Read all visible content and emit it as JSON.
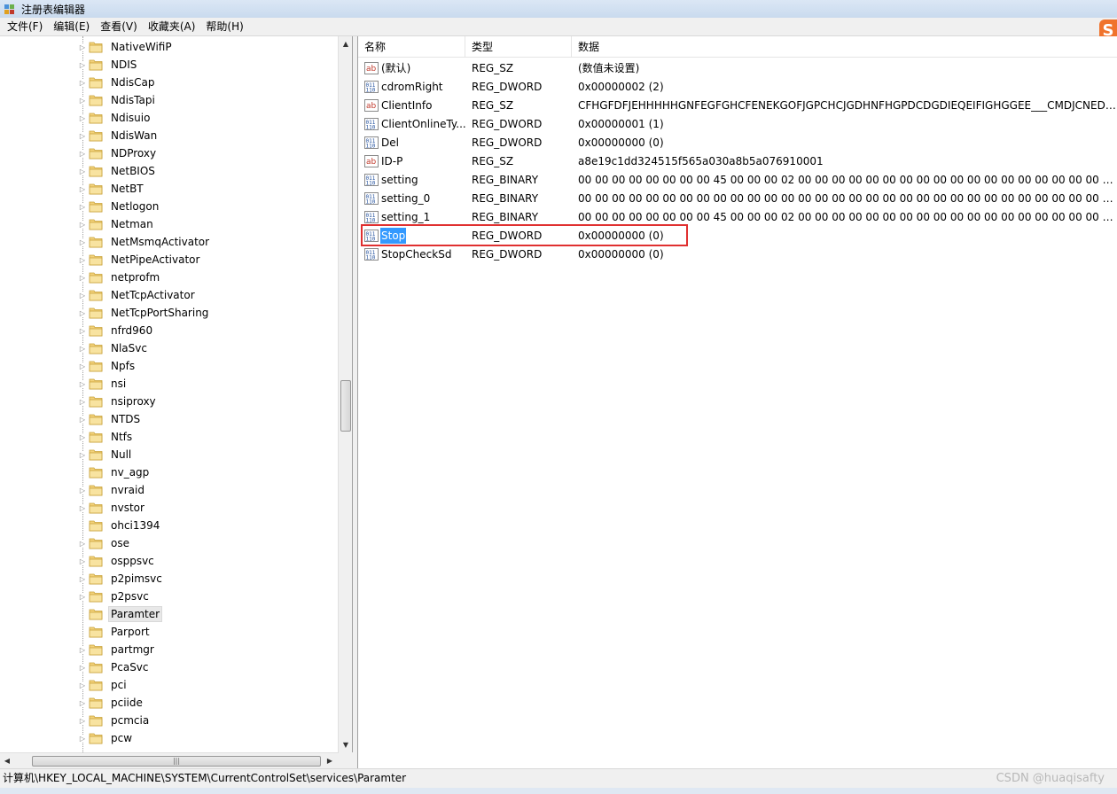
{
  "window": {
    "title": "注册表编辑器"
  },
  "menu": [
    "文件(F)",
    "编辑(E)",
    "查看(V)",
    "收藏夹(A)",
    "帮助(H)"
  ],
  "tree": {
    "items": [
      {
        "label": "NativeWifiP",
        "expandable": true
      },
      {
        "label": "NDIS",
        "expandable": true
      },
      {
        "label": "NdisCap",
        "expandable": true
      },
      {
        "label": "NdisTapi",
        "expandable": true
      },
      {
        "label": "Ndisuio",
        "expandable": true
      },
      {
        "label": "NdisWan",
        "expandable": true
      },
      {
        "label": "NDProxy",
        "expandable": true
      },
      {
        "label": "NetBIOS",
        "expandable": true
      },
      {
        "label": "NetBT",
        "expandable": true
      },
      {
        "label": "Netlogon",
        "expandable": true
      },
      {
        "label": "Netman",
        "expandable": true
      },
      {
        "label": "NetMsmqActivator",
        "expandable": true
      },
      {
        "label": "NetPipeActivator",
        "expandable": true
      },
      {
        "label": "netprofm",
        "expandable": true
      },
      {
        "label": "NetTcpActivator",
        "expandable": true
      },
      {
        "label": "NetTcpPortSharing",
        "expandable": true
      },
      {
        "label": "nfrd960",
        "expandable": true
      },
      {
        "label": "NlaSvc",
        "expandable": true
      },
      {
        "label": "Npfs",
        "expandable": true
      },
      {
        "label": "nsi",
        "expandable": true
      },
      {
        "label": "nsiproxy",
        "expandable": true
      },
      {
        "label": "NTDS",
        "expandable": true
      },
      {
        "label": "Ntfs",
        "expandable": true
      },
      {
        "label": "Null",
        "expandable": true
      },
      {
        "label": "nv_agp",
        "expandable": false
      },
      {
        "label": "nvraid",
        "expandable": true
      },
      {
        "label": "nvstor",
        "expandable": true
      },
      {
        "label": "ohci1394",
        "expandable": false
      },
      {
        "label": "ose",
        "expandable": true
      },
      {
        "label": "osppsvc",
        "expandable": true
      },
      {
        "label": "p2pimsvc",
        "expandable": true
      },
      {
        "label": "p2psvc",
        "expandable": true
      },
      {
        "label": "Paramter",
        "expandable": false,
        "selected": true
      },
      {
        "label": "Parport",
        "expandable": false
      },
      {
        "label": "partmgr",
        "expandable": true
      },
      {
        "label": "PcaSvc",
        "expandable": true
      },
      {
        "label": "pci",
        "expandable": true
      },
      {
        "label": "pciide",
        "expandable": true
      },
      {
        "label": "pcmcia",
        "expandable": true
      },
      {
        "label": "pcw",
        "expandable": true
      }
    ]
  },
  "values": {
    "headers": {
      "name": "名称",
      "type": "类型",
      "data": "数据"
    },
    "rows": [
      {
        "icon": "string-value-icon",
        "name": "(默认)",
        "type": "REG_SZ",
        "data": "(数值未设置)"
      },
      {
        "icon": "binary-value-icon",
        "name": "cdromRight",
        "type": "REG_DWORD",
        "data": "0x00000002 (2)"
      },
      {
        "icon": "string-value-icon",
        "name": "ClientInfo",
        "type": "REG_SZ",
        "data": "CFHGFDFJEHHHHHGNFEGFGHCFENEKGOFJGPCHCJGDHNFHGPDCDGDIEQEIFIGHGGEE___CMDJCNEDHL..."
      },
      {
        "icon": "binary-value-icon",
        "name": "ClientOnlineTy...",
        "type": "REG_DWORD",
        "data": "0x00000001 (1)"
      },
      {
        "icon": "binary-value-icon",
        "name": "Del",
        "type": "REG_DWORD",
        "data": "0x00000000 (0)"
      },
      {
        "icon": "string-value-icon",
        "name": "ID-P",
        "type": "REG_SZ",
        "data": "a8e19c1dd324515f565a030a8b5a076910001"
      },
      {
        "icon": "binary-value-icon",
        "name": "setting",
        "type": "REG_BINARY",
        "data": "00 00 00 00 00 00 00 00 45 00 00 00 02 00 00 00 00 00 00 00 00 00 00 00 00 00 00 00 00 00 00 00 0..."
      },
      {
        "icon": "binary-value-icon",
        "name": "setting_0",
        "type": "REG_BINARY",
        "data": "00 00 00 00 00 00 00 00 00 00 00 00 00 00 00 00 00 00 00 00 00 00 00 00 00 00 00 00 00 00 00 00 0..."
      },
      {
        "icon": "binary-value-icon",
        "name": "setting_1",
        "type": "REG_BINARY",
        "data": "00 00 00 00 00 00 00 00 45 00 00 00 02 00 00 00 00 00 00 00 00 00 00 00 00 00 00 00 00 00 00 00 0..."
      },
      {
        "icon": "binary-value-icon",
        "name": "Stop",
        "type": "REG_DWORD",
        "data": "0x00000000 (0)",
        "selected": true
      },
      {
        "icon": "binary-value-icon",
        "name": "StopCheckSd",
        "type": "REG_DWORD",
        "data": "0x00000000 (0)"
      }
    ]
  },
  "status": {
    "path": "计算机\\HKEY_LOCAL_MACHINE\\SYSTEM\\CurrentControlSet\\services\\Paramter"
  },
  "watermark": "CSDN @huaqisafty",
  "colors": {
    "selection": "#3399ff",
    "highlight_box": "#e03030",
    "folder": "#f3d27a"
  }
}
